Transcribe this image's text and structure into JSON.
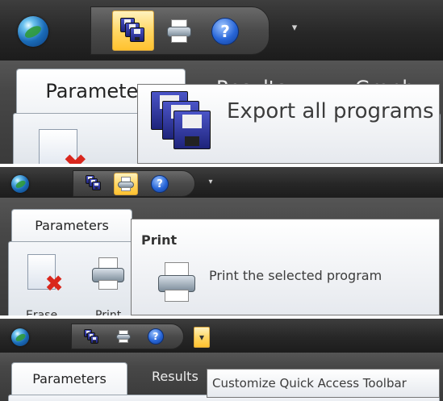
{
  "panel1": {
    "tab_active": "Parameters",
    "tab_partial_1": "Results",
    "tab_partial_2": "Graph",
    "tooltip_title": "Export all programs",
    "icons": [
      "app-orb-icon",
      "export-programs-icon",
      "print-icon",
      "help-icon",
      "qat-dropdown-icon",
      "erase-icon"
    ]
  },
  "panel2": {
    "tab_active": "Parameters",
    "tooltip_title": "Print",
    "tooltip_text": "Print the selected program",
    "label_erase": "Erase",
    "label_print": "Print"
  },
  "panel3": {
    "tab_active": "Parameters",
    "tab_results": "Results",
    "tooltip_text": "Customize Quick Access Toolbar"
  },
  "icon_glyphs": {
    "help": "?",
    "dropdown": "▾",
    "erase_x": "✖"
  },
  "colors": {
    "title_bar": "#272727",
    "active_button": "#ffd766",
    "tooltip_border": "#767676"
  }
}
